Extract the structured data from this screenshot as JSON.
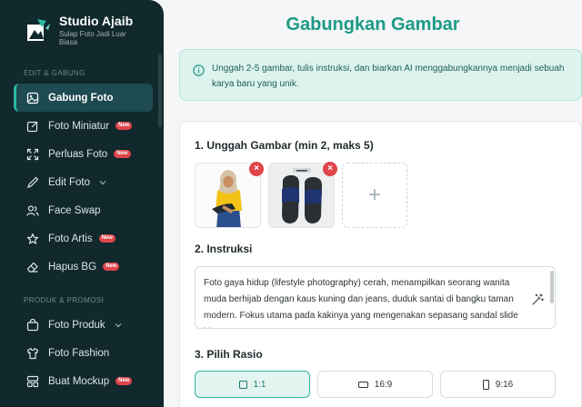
{
  "brand": {
    "title": "Studio Ajaib",
    "subtitle": "Sulap Foto Jadi Luar Biasa"
  },
  "sidebar": {
    "sections": [
      {
        "label": "EDIT & GABUNG",
        "items": [
          {
            "label": "Gabung Foto",
            "icon": "image-icon",
            "active": true
          },
          {
            "label": "Foto Miniatur",
            "icon": "edit-square-icon",
            "badge": "New"
          },
          {
            "label": "Perluas Foto",
            "icon": "expand-icon",
            "badge": "New"
          },
          {
            "label": "Edit Foto",
            "icon": "pencil-icon",
            "chevron": true
          },
          {
            "label": "Face Swap",
            "icon": "users-icon"
          },
          {
            "label": "Foto Artis",
            "icon": "star-icon",
            "badge": "New"
          },
          {
            "label": "Hapus BG",
            "icon": "eraser-icon",
            "badge": "New"
          }
        ]
      },
      {
        "label": "PRODUK & PROMOSI",
        "items": [
          {
            "label": "Foto Produk",
            "icon": "bag-icon",
            "chevron": true
          },
          {
            "label": "Foto Fashion",
            "icon": "shirt-icon"
          },
          {
            "label": "Buat Mockup",
            "icon": "layout-icon",
            "badge": "New"
          }
        ]
      }
    ]
  },
  "main": {
    "title": "Gabungkan Gambar",
    "info": "Unggah 2-5 gambar, tulis instruksi, dan biarkan AI menggabungkannya menjadi sebuah karya baru yang unik.",
    "step1_label": "1. Unggah Gambar (min 2, maks 5)",
    "step2_label": "2. Instruksi",
    "instruction_text": "Foto gaya hidup (lifestyle photography) cerah, menampilkan seorang wanita muda berhijab dengan kaus kuning dan jeans, duduk santai di bangku taman modern. Fokus utama pada kakinya yang mengenakan sepasang sandal slide biru tua",
    "step3_label": "3. Pilih Rasio",
    "ratios": [
      {
        "label": "1:1",
        "active": true
      },
      {
        "label": "16:9",
        "active": false
      },
      {
        "label": "9:16",
        "active": false
      }
    ],
    "remove_symbol": "×",
    "add_symbol": "+"
  },
  "colors": {
    "accent": "#1b9a86",
    "sidebar_bg": "#11282d",
    "badge": "#e0454a"
  }
}
